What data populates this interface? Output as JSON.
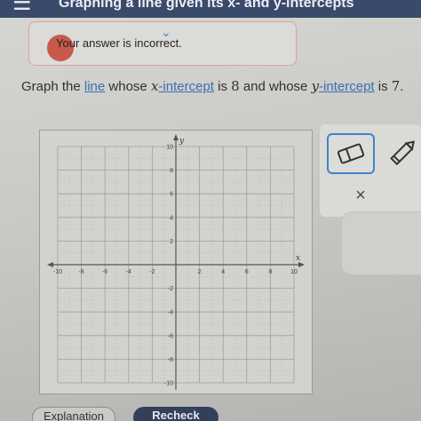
{
  "topbar": {
    "menu_icon": "hamburger-menu-icon",
    "title": "Graphing a line given its x- and y-intercepts"
  },
  "feedback": {
    "message": "Your answer is incorrect.",
    "icon": "chevron-down-icon",
    "color": "#d9a3a3"
  },
  "question": {
    "prefix": "Graph the ",
    "line_link": "line",
    "part2": " whose ",
    "x_var": "x",
    "x_link": "-intercept",
    "part3": " is ",
    "x_value": "8",
    "part4": " and whose ",
    "y_var": "y",
    "y_link": "-intercept",
    "part5": " is ",
    "y_value": "7",
    "suffix": "."
  },
  "graph": {
    "x_label": "x",
    "y_label": "y",
    "x_ticks": [
      "-10",
      "-8",
      "-6",
      "-4",
      "-2",
      "2",
      "4",
      "6",
      "8",
      "10"
    ],
    "y_ticks": [
      "10",
      "8",
      "6",
      "4",
      "2",
      "-2",
      "-4",
      "-6",
      "-8",
      "-10"
    ],
    "range": [
      -10,
      10
    ],
    "grid": true
  },
  "tools": {
    "eraser_icon": "eraser-icon",
    "pencil_icon": "pencil-icon",
    "close_icon": "close-icon",
    "close_glyph": "×",
    "accent": "#3f86c6"
  },
  "bottom": {
    "explanation": "Explanation",
    "recheck": "Recheck"
  }
}
